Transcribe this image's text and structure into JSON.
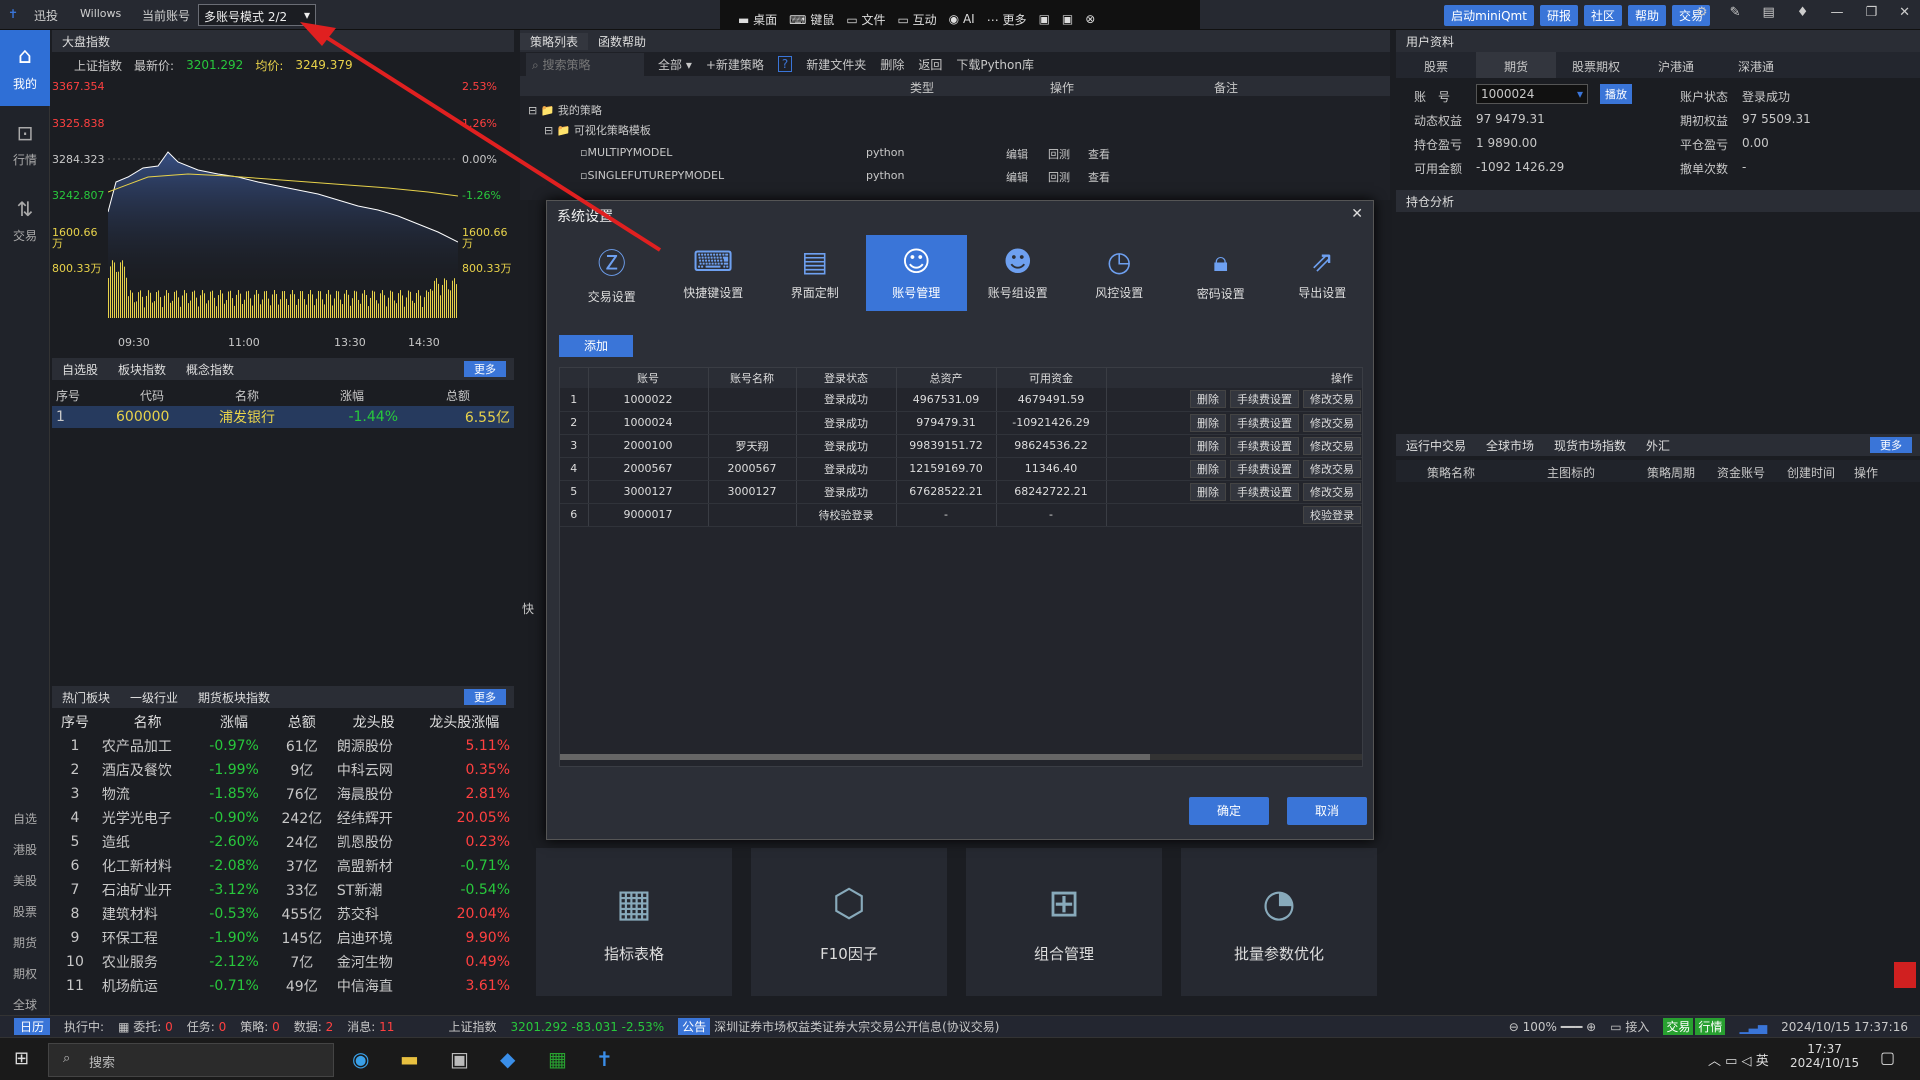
{
  "titlebar": {
    "app": "迅投",
    "user": "Willows",
    "account_label": "当前账号",
    "account_mode": "多账号模式 2/2",
    "mid_items": [
      "桌面",
      "键鼠",
      "文件",
      "互动",
      "AI",
      "更多"
    ],
    "right_buttons": [
      "启动miniQmt",
      "研报",
      "社区",
      "帮助",
      "交易"
    ]
  },
  "leftbar": {
    "items": [
      "我的",
      "行情",
      "交易"
    ],
    "bottom": [
      "自选",
      "港股",
      "美股",
      "股票",
      "期货",
      "期权",
      "全球"
    ]
  },
  "index_panel": {
    "tab": "大盘指数",
    "name": "上证指数",
    "last_label": "最新价:",
    "last": "3201.292",
    "avg_label": "均价:",
    "avg": "3249.379",
    "y_left": [
      "3367.354",
      "3325.838",
      "3284.323",
      "3242.807",
      "1600.66万",
      "800.33万"
    ],
    "y_right": [
      "2.53%",
      "1.26%",
      "0.00%",
      "-1.26%",
      "1600.66万",
      "800.33万"
    ],
    "x_ticks": [
      "09:30",
      "11:00",
      "13:30",
      "14:30"
    ]
  },
  "watch": {
    "tabs": [
      "自选股",
      "板块指数",
      "概念指数"
    ],
    "more": "更多",
    "headers": [
      "序号",
      "代码",
      "名称",
      "涨幅",
      "总额"
    ],
    "rows": [
      {
        "n": "1",
        "code": "600000",
        "name": "浦发银行",
        "chg": "-1.44%",
        "amt": "6.55亿"
      }
    ]
  },
  "sectors": {
    "tabs": [
      "热门板块",
      "一级行业",
      "期货板块指数"
    ],
    "more": "更多",
    "headers": [
      "序号",
      "名称",
      "涨幅",
      "总额",
      "龙头股",
      "龙头股涨幅"
    ],
    "rows": [
      [
        "1",
        "农产品加工",
        "-0.97%",
        "61亿",
        "朗源股份",
        "5.11%"
      ],
      [
        "2",
        "酒店及餐饮",
        "-1.99%",
        "9亿",
        "中科云网",
        "0.35%"
      ],
      [
        "3",
        "物流",
        "-1.85%",
        "76亿",
        "海晨股份",
        "2.81%"
      ],
      [
        "4",
        "光学光电子",
        "-0.90%",
        "242亿",
        "经纬辉开",
        "20.05%"
      ],
      [
        "5",
        "造纸",
        "-2.60%",
        "24亿",
        "凯恩股份",
        "0.23%"
      ],
      [
        "6",
        "化工新材料",
        "-2.08%",
        "37亿",
        "高盟新材",
        "-0.71%"
      ],
      [
        "7",
        "石油矿业开",
        "-3.12%",
        "33亿",
        "ST新潮",
        "-0.54%"
      ],
      [
        "8",
        "建筑材料",
        "-0.53%",
        "455亿",
        "苏交科",
        "20.04%"
      ],
      [
        "9",
        "环保工程",
        "-1.90%",
        "145亿",
        "启迪环境",
        "9.90%"
      ],
      [
        "10",
        "农业服务",
        "-2.12%",
        "7亿",
        "金河生物",
        "0.49%"
      ],
      [
        "11",
        "机场航运",
        "-0.71%",
        "49亿",
        "中信海直",
        "3.61%"
      ]
    ]
  },
  "strategy": {
    "tabs": [
      "策略列表",
      "函数帮助"
    ],
    "search_placeholder": "搜索策略",
    "filter": "全部",
    "toolbar": [
      "+新建策略",
      "?",
      "新建文件夹",
      "删除",
      "返回",
      "下载Python库"
    ],
    "headers": [
      "类型",
      "操作",
      "备注"
    ],
    "tree": [
      "我的策略",
      "可视化策略模板"
    ],
    "items": [
      {
        "name": "MULTIPYMODEL",
        "type": "python",
        "ops": [
          "编辑",
          "回测",
          "查看"
        ]
      },
      {
        "name": "SINGLEFUTUREPYMODEL",
        "type": "python",
        "ops": [
          "编辑",
          "回测",
          "查看"
        ]
      }
    ]
  },
  "dialog": {
    "title": "系统设置",
    "tabs": [
      "交易设置",
      "快捷键设置",
      "界面定制",
      "账号管理",
      "账号组设置",
      "风控设置",
      "密码设置",
      "导出设置"
    ],
    "add": "添加",
    "headers": [
      "",
      "账号",
      "账号名称",
      "登录状态",
      "总资产",
      "可用资金",
      "操作"
    ],
    "rows": [
      {
        "n": "1",
        "acc": "1000022",
        "name": "",
        "status": "登录成功",
        "total": "4967531.09",
        "avail": "4679491.59",
        "ops": [
          "删除",
          "手续费设置",
          "修改交易"
        ]
      },
      {
        "n": "2",
        "acc": "1000024",
        "name": "",
        "status": "登录成功",
        "total": "979479.31",
        "avail": "-10921426.29",
        "ops": [
          "删除",
          "手续费设置",
          "修改交易"
        ]
      },
      {
        "n": "3",
        "acc": "2000100",
        "name": "罗天翔",
        "status": "登录成功",
        "total": "99839151.72",
        "avail": "98624536.22",
        "ops": [
          "删除",
          "手续费设置",
          "修改交易"
        ]
      },
      {
        "n": "4",
        "acc": "2000567",
        "name": "2000567",
        "status": "登录成功",
        "total": "12159169.70",
        "avail": "11346.40",
        "ops": [
          "删除",
          "手续费设置",
          "修改交易"
        ]
      },
      {
        "n": "5",
        "acc": "3000127",
        "name": "3000127",
        "status": "登录成功",
        "total": "67628522.21",
        "avail": "68242722.21",
        "ops": [
          "删除",
          "手续费设置",
          "修改交易"
        ]
      },
      {
        "n": "6",
        "acc": "9000017",
        "name": "",
        "status": "待校验登录",
        "total": "-",
        "avail": "-",
        "ops": [
          "校验登录"
        ]
      }
    ],
    "ok": "确定",
    "cancel": "取消"
  },
  "tools": [
    "指标表格",
    "F10因子",
    "组合管理",
    "批量参数优化"
  ],
  "side_label": "快",
  "user": {
    "tab": "用户资料",
    "subtabs": [
      "股票",
      "期货",
      "股票期权",
      "沪港通",
      "深港通"
    ],
    "acc_label": "账　号",
    "acc": "1000024",
    "switch": "播放",
    "fields": [
      [
        "账户状态",
        "登录成功"
      ],
      [
        "动态权益",
        "97 9479.31"
      ],
      [
        "期初权益",
        "97 5509.31"
      ],
      [
        "持仓盈亏",
        "1 9890.00"
      ],
      [
        "平仓盈亏",
        "0.00"
      ],
      [
        "可用金额",
        "-1092 1426.29"
      ],
      [
        "撤单次数",
        "-"
      ]
    ],
    "analysis": "持仓分析"
  },
  "running": {
    "tabs": [
      "运行中交易",
      "全球市场",
      "现货市场指数",
      "外汇"
    ],
    "more": "更多",
    "headers": [
      "策略名称",
      "主图标的",
      "策略周期",
      "资金账号",
      "创建时间",
      "操作"
    ]
  },
  "status": {
    "calendar": "日历",
    "exec": "执行中:",
    "entrust": "委托:",
    "entrust_n": "0",
    "task": "任务:",
    "task_n": "0",
    "strat": "策略:",
    "strat_n": "0",
    "data": "数据:",
    "data_n": "2",
    "msg": "消息:",
    "msg_n": "11",
    "idx": "上证指数",
    "idx_vals": "3201.292  -83.031  -2.53%",
    "notice": "公告",
    "notice_text": "深圳证券市场权益类证券大宗交易公开信息(协议交易)",
    "zoom": "100%",
    "insert": "接入",
    "trade": "交易",
    "quote": "行情",
    "datetime": "2024/10/15 17:37:16"
  },
  "taskbar": {
    "search": "搜索",
    "time": "17:37",
    "date": "2024/10/15",
    "ime": "英"
  },
  "colors": {
    "accent": "#3a75d8",
    "red": "#ff4040",
    "green": "#28c83c",
    "arrow": "#e02020"
  }
}
